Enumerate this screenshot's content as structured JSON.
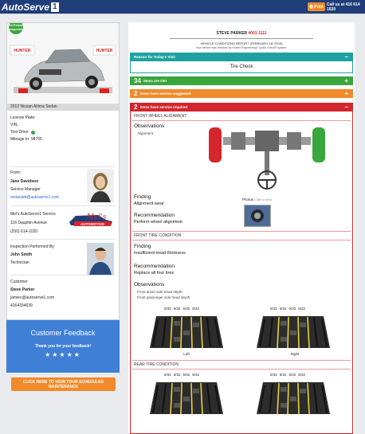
{
  "header": {
    "logo_text": "AutoServe",
    "logo_num": "1",
    "print_label": "Print",
    "call_text": "Call us at 416 614 1020"
  },
  "vehicle": {
    "badge": "24 Points Inspection",
    "photo_brand": "HUNTER",
    "name": "2012 Nissan Altima Sedan",
    "plate_label": "License Plate:",
    "vin_label": "VIN:",
    "test_drive_label": "Test Drive:",
    "mileage_label": "Mileage In:",
    "mileage_value": "98765"
  },
  "from": {
    "label": "From:",
    "name": "Jane Davidson",
    "role": "Service Manager",
    "email": "melanieb@autoserve1.com"
  },
  "shop": {
    "name": "Mel's AutoServe1 Service",
    "address": "116 Dauphin Avenue",
    "phone": "(250) 614-1020",
    "logo_line1": "Mel's",
    "logo_line2": "AUTOMOTIVE"
  },
  "inspector": {
    "label": "Inspection Performed By:",
    "name": "John Smith",
    "role": "Technician"
  },
  "customer": {
    "label": "Customer",
    "name": "Steve Parker",
    "email": "jamiec@autoserve1.com",
    "phone": "4164334639"
  },
  "feedback": {
    "title": "Customer Feedback",
    "thanks": "Thank you for your feedback!",
    "stars": "★★★★★"
  },
  "schedule_button": "CLICK HERE TO VIEW YOUR SCHEDULED MAINTENANCE",
  "report": {
    "customer_name": "STEVE PARKER",
    "customer_id": "#001-1111",
    "title": "VEHICLE CONDITIONS REPORT (FEBRUARY 18, 2016)",
    "subtitle": "Your vehicle was checked by Hunter Engineering's Quick Check® system."
  },
  "bars": {
    "reason": "Reason for Today's Visit",
    "reason_value": "Tire Check",
    "ok_count": "34",
    "ok_label": "Items are OK!",
    "suggested_count": "2",
    "suggested_label": "Items have service suggested",
    "required_count": "2",
    "required_label": "Items have service required",
    "minus": "−",
    "plus": "+"
  },
  "alignment": {
    "section": "FRONT WHEEL ALIGNMENT",
    "obs_label": "Observations",
    "obs_value": "Alignment",
    "finding_label": "Finding",
    "finding_value": "Alignment wear",
    "rec_label": "Recommendation",
    "rec_value": "Perform wheel alignment",
    "photos_label": "Photos",
    "photos_hint": "(Click to view)"
  },
  "front_tire": {
    "section": "FRONT TIRE CONDITION",
    "finding_label": "Finding",
    "finding_value": "Insufficient tread thickness",
    "rec_label": "Recommendation",
    "rec_value": "Replace all four tires",
    "obs_label": "Observations",
    "obs_line1": "Front driver side tread depth:",
    "obs_line2": "Front passenger side tread depth:",
    "left_depths": [
      "5/32",
      "6/32",
      "6/32",
      "5/32"
    ],
    "right_depths": [
      "5/32",
      "6/32",
      "6/32",
      "5/32"
    ],
    "left_label": "Left",
    "right_label": "Right"
  },
  "rear_tire": {
    "section": "REAR TIRE CONDITION",
    "left_depths": [
      "5/32",
      "5/32",
      "5/32",
      "5/32"
    ],
    "right_depths": [
      "5/32",
      "5/32",
      "5/32",
      "5/32"
    ]
  },
  "colors": {
    "navy": "#1f3d78",
    "teal": "#1ea29f",
    "green": "#3aa63e",
    "orange": "#f08a2b",
    "red": "#d4262c",
    "blue": "#3f7fd6"
  }
}
